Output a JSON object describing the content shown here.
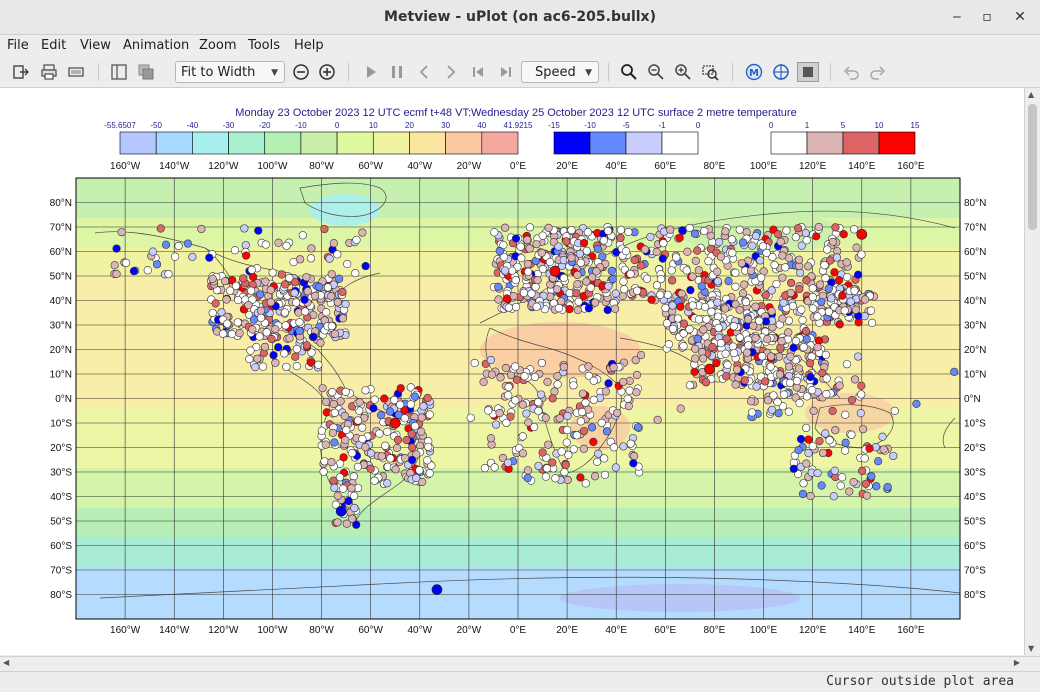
{
  "window": {
    "title": "Metview - uPlot (on ac6-205.bullx)",
    "minimize_glyph": "‒",
    "maximize_glyph": "▫",
    "close_glyph": "✕"
  },
  "menu": [
    "File",
    "Edit",
    "View",
    "Animation",
    "Zoom",
    "Tools",
    "Help"
  ],
  "toolbar": {
    "zoom_mode": "Fit to Width",
    "speed_label": "Speed",
    "icons": [
      "export-icon",
      "print-icon",
      "print-preview-icon",
      "sidebar-toggle-icon",
      "layers-icon",
      "zoom-out-circle-icon",
      "zoom-in-circle-icon",
      "play-icon",
      "pause-icon",
      "previous-icon",
      "next-icon",
      "first-frame-icon",
      "last-frame-icon",
      "magnifier-icon",
      "zoom-out-icon",
      "zoom-in-icon",
      "zoom-area-icon",
      "metview-icon",
      "cursor-data-icon",
      "inspector-icon",
      "undo-icon",
      "redo-icon"
    ]
  },
  "plot": {
    "title": "Monday 23 October 2023 12 UTC ecmf t+48 VT:Wednesday 25 October 2023 12 UTC surface  2 metre temperature",
    "legend_background": {
      "labels": [
        "-55.6507",
        "-50",
        "-40",
        "-30",
        "-20",
        "-10",
        "0",
        "10",
        "20",
        "30",
        "40",
        "41.9215"
      ],
      "colors": [
        "#b4c8ff",
        "#a8d8ff",
        "#a8f0f0",
        "#a8f0d0",
        "#b4f0b4",
        "#c8f0a8",
        "#e0f8a0",
        "#f0f4a0",
        "#fae6a0",
        "#fac8a0",
        "#f4a8a0"
      ]
    },
    "legend_obs_cold": {
      "labels": [
        "-15",
        "-10",
        "-5",
        "-1",
        "0"
      ],
      "colors": [
        "#0000ff",
        "#6688ff",
        "#c8ccff",
        "#ffffff"
      ]
    },
    "legend_obs_warm": {
      "labels": [
        "0",
        "1",
        "5",
        "10",
        "15"
      ],
      "colors": [
        "#ffffff",
        "#dcb4b4",
        "#dc6464",
        "#ff0000"
      ]
    },
    "lon_labels": [
      "160°W",
      "140°W",
      "120°W",
      "100°W",
      "80°W",
      "60°W",
      "40°W",
      "20°W",
      "0°E",
      "20°E",
      "40°E",
      "60°E",
      "80°E",
      "100°E",
      "120°E",
      "140°E",
      "160°E"
    ],
    "lat_labels": [
      "80°N",
      "70°N",
      "60°N",
      "50°N",
      "40°N",
      "30°N",
      "20°N",
      "10°N",
      "0°N",
      "10°S",
      "20°S",
      "30°S",
      "40°S",
      "50°S",
      "60°S",
      "70°S",
      "80°S"
    ],
    "lon_values": [
      -160,
      -140,
      -120,
      -100,
      -80,
      -60,
      -40,
      -20,
      0,
      20,
      40,
      60,
      80,
      100,
      120,
      140,
      160
    ],
    "lat_values": [
      80,
      70,
      60,
      50,
      40,
      30,
      20,
      10,
      0,
      -10,
      -20,
      -30,
      -40,
      -50,
      -60,
      -70,
      -80
    ]
  },
  "status": {
    "text": "Cursor outside plot area"
  }
}
